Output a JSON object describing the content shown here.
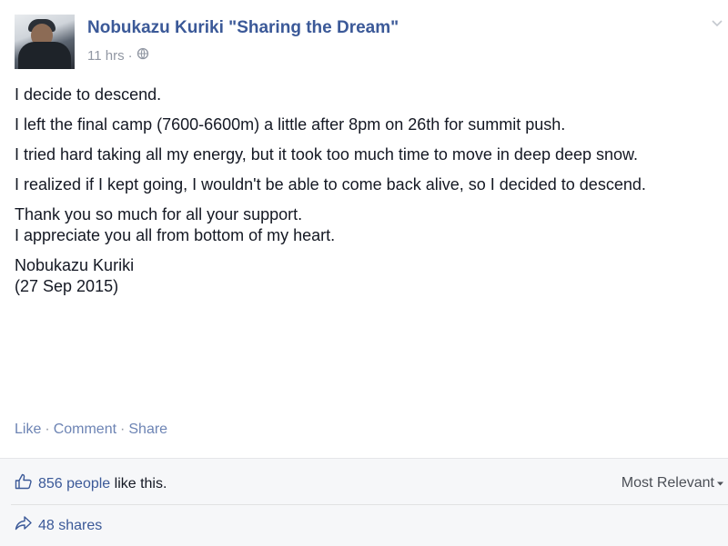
{
  "post": {
    "author": "Nobukazu Kuriki \"Sharing the Dream\"",
    "time": "11 hrs",
    "meta_separator": "·",
    "privacy_icon": "globe-icon",
    "paragraphs": [
      "I decide to descend.",
      "I left the final camp (7600-6600m) a little after 8pm on 26th for summit push.",
      "I tried hard taking all my energy, but it took too much time to move in deep deep snow.",
      "I realized if I kept going, I wouldn't be able to come back alive, so I decided to descend.",
      "Thank you so much for all your support.",
      "I appreciate you all from bottom of my heart.",
      "Nobukazu Kuriki",
      "(27 Sep 2015)"
    ]
  },
  "actions": {
    "like": "Like",
    "comment": "Comment",
    "share": "Share",
    "separator": "·"
  },
  "feedback": {
    "likes_count": "856 people",
    "likes_suffix": " like this.",
    "sort_label": "Most Relevant",
    "shares": "48 shares"
  },
  "colors": {
    "link": "#3b5998",
    "muted": "#9197a3",
    "panel_bg": "#f6f7f9"
  }
}
